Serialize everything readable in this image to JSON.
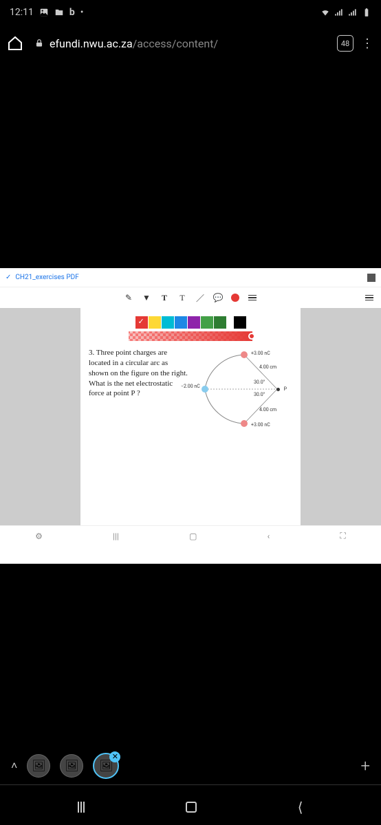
{
  "status": {
    "time": "12:11",
    "icon_letter": "b"
  },
  "browser": {
    "url_host": "efundi.nwu.ac.za",
    "url_path": "/access/content/",
    "tab_count": "48"
  },
  "pdf": {
    "filename": "CH21_exercises PDF",
    "toolbar": {
      "text_tool_1": "T",
      "text_tool_2": "T"
    }
  },
  "palette": {
    "colors": [
      "#e53935",
      "#fdd835",
      "#00bcd4",
      "#1e88e5",
      "#8e24aa",
      "#43a047",
      "#2e7d32",
      "#000000"
    ]
  },
  "question": {
    "text": "3. Three point charges are located in a circular arc as shown on the figure on the right. What is the net electrostatic force at point P ?",
    "labels": {
      "charge_top": "+3.00 nC",
      "charge_left": "−2.00 nC",
      "charge_bottom": "+3.00 nC",
      "radius_top": "4.00 cm",
      "radius_bottom": "4.00 cm",
      "angle_top": "30.0°",
      "angle_bottom": "30.0°",
      "point": "P"
    }
  },
  "pdf_nav": {
    "recent": "|||",
    "square": "▢",
    "back": "‹"
  },
  "thumbs": {
    "close": "✕",
    "plus": "+"
  }
}
